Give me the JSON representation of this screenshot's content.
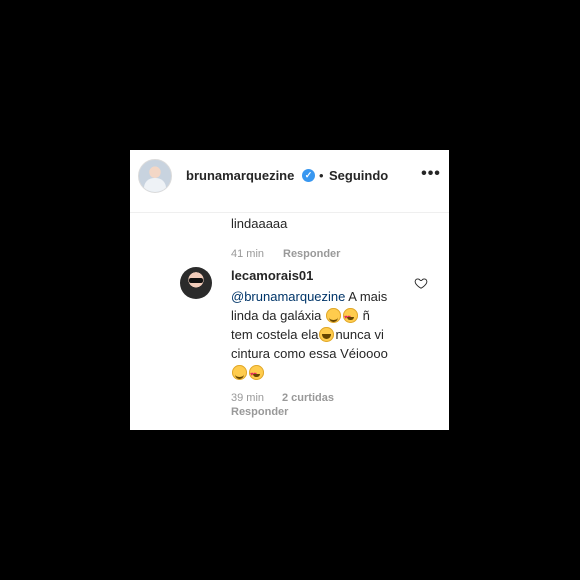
{
  "post_header": {
    "username": "brunamarquezine",
    "separator": "•",
    "follow_status": "Seguindo",
    "more_glyph": "•••"
  },
  "previous_comment": {
    "text": "lindaaaaa",
    "time": "41 min",
    "reply_label": "Responder"
  },
  "comment": {
    "username": "lecamorais01",
    "mention": "@brunamarquezine",
    "line1_rest": "A mais",
    "line2": "linda da galáxia",
    "line2_tail": "ñ",
    "line3_a": "tem costela ela",
    "line3_b": "nunca vi",
    "line4": "cintura como essa Véioooo",
    "time": "39 min",
    "likes": "2 curtidas",
    "reply_label": "Responder"
  },
  "colors": {
    "verified": "#3897f0",
    "text": "#262626",
    "meta": "#999999",
    "mention": "#003569"
  },
  "icons": [
    "verified-badge-icon",
    "more-options-icon",
    "like-heart-icon"
  ]
}
